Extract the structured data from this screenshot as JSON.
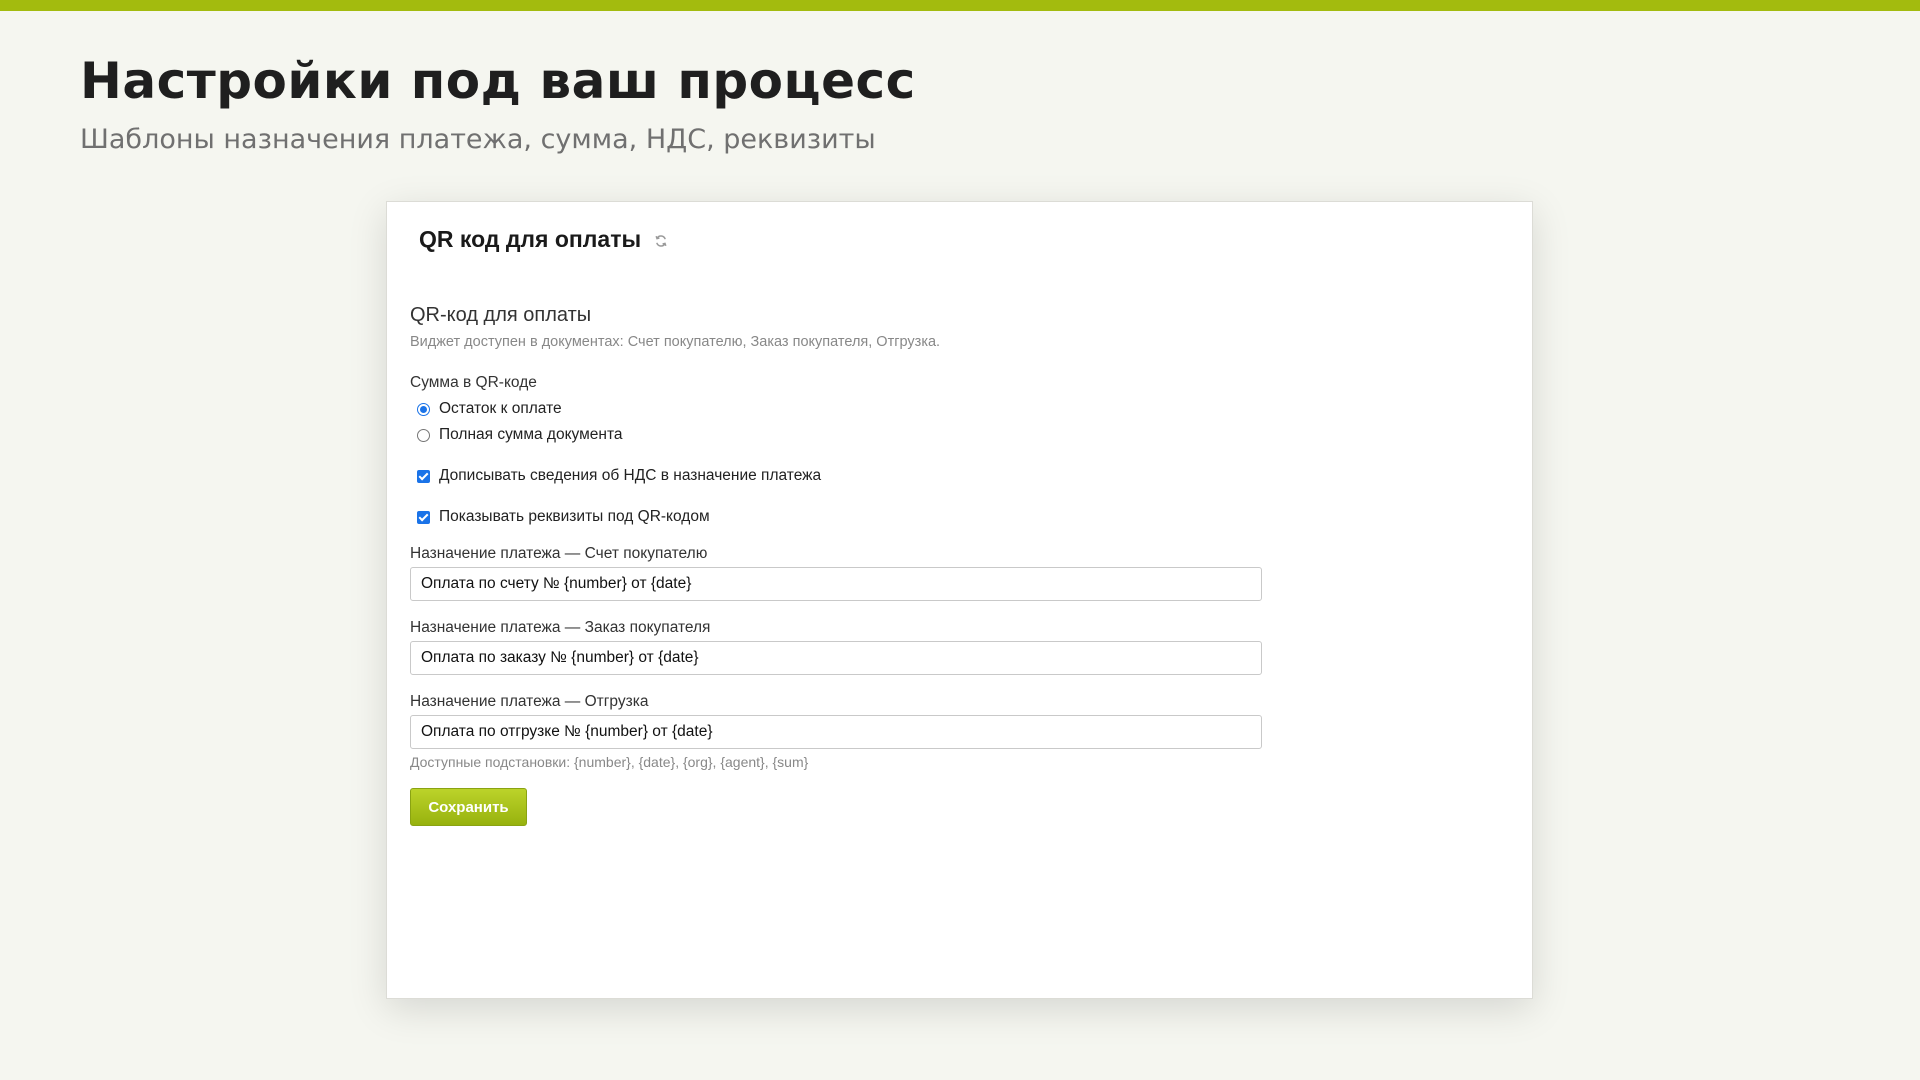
{
  "page": {
    "title": "Настройки под ваш процесс",
    "subtitle": "Шаблоны назначения платежа, сумма, НДС, реквизиты"
  },
  "colors": {
    "accent": "#a3bb0e",
    "button_top": "#bcd32a",
    "button_bottom": "#97b20e",
    "control_blue": "#1a73e8"
  },
  "card": {
    "title": "QR код для оплаты",
    "refresh_icon": "refresh-icon",
    "widget_title": "QR-код для оплаты",
    "widget_description": "Виджет доступен в документах: Счет покупателю, Заказ покупателя, Отгрузка.",
    "amount_group": {
      "label": "Сумма в QR-коде",
      "options": [
        {
          "label": "Остаток к оплате",
          "selected": true
        },
        {
          "label": "Полная сумма документа",
          "selected": false
        }
      ]
    },
    "checkboxes": [
      {
        "label": "Дописывать сведения об НДС в назначение платежа",
        "checked": true
      },
      {
        "label": "Показывать реквизиты под QR-кодом",
        "checked": true
      }
    ],
    "fields": [
      {
        "label": "Назначение платежа — Счет покупателю",
        "value": "Оплата по счету № {number} от {date}"
      },
      {
        "label": "Назначение платежа — Заказ покупателя",
        "value": "Оплата по заказу № {number} от {date}"
      },
      {
        "label": "Назначение платежа — Отгрузка",
        "value": "Оплата по отгрузке № {number} от {date}"
      }
    ],
    "hint": "Доступные подстановки: {number}, {date}, {org}, {agent}, {sum}",
    "save_label": "Сохранить"
  }
}
